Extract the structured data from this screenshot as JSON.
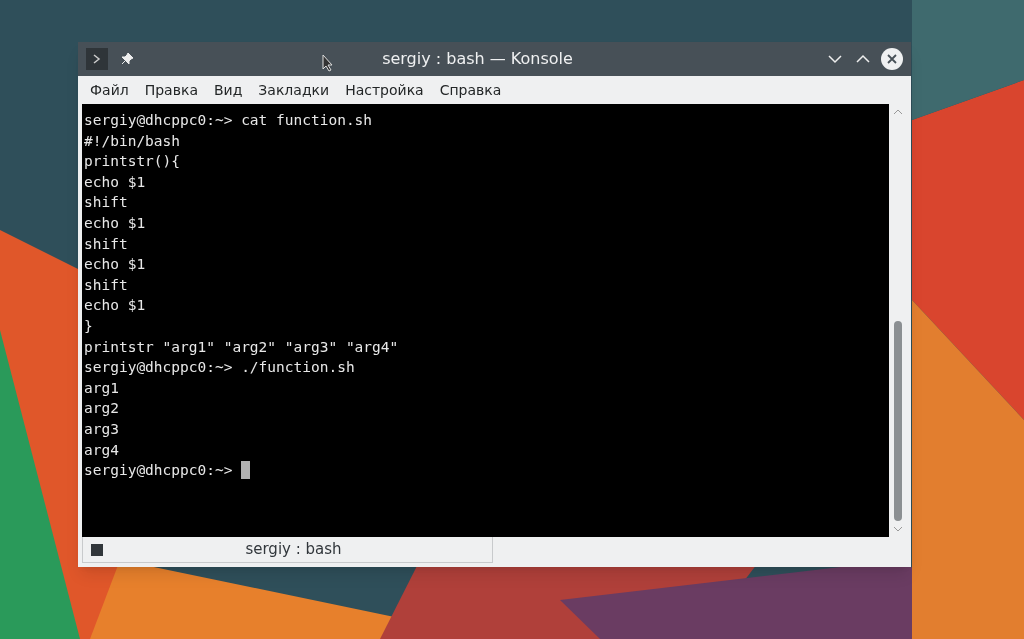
{
  "window": {
    "title": "sergiy : bash — Konsole"
  },
  "menu": [
    "Файл",
    "Правка",
    "Вид",
    "Закладки",
    "Настройка",
    "Справка"
  ],
  "terminal": {
    "lines": [
      "sergiy@dhcppc0:~> cat function.sh",
      "#!/bin/bash",
      "printstr(){",
      "echo $1",
      "shift",
      "echo $1",
      "shift",
      "echo $1",
      "shift",
      "echo $1",
      "}",
      "printstr \"arg1\" \"arg2\" \"arg3\" \"arg4\"",
      "sergiy@dhcppc0:~> ./function.sh",
      "arg1",
      "arg2",
      "arg3",
      "arg4",
      "sergiy@dhcppc0:~> "
    ]
  },
  "tabs": [
    {
      "label": "sergiy : bash",
      "selected": true
    }
  ]
}
